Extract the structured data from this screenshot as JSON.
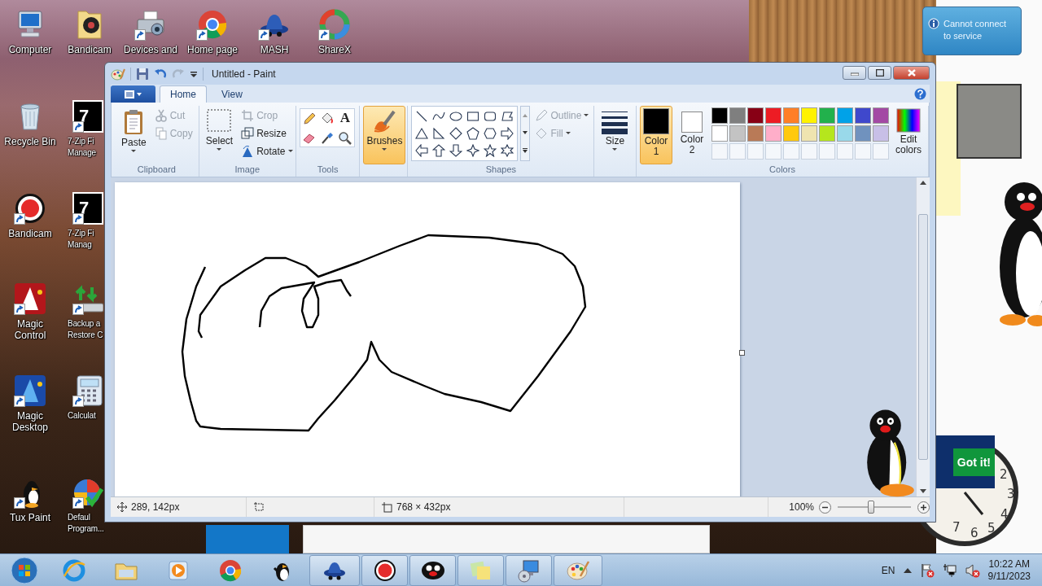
{
  "desktop_icons": [
    {
      "label": "Computer",
      "shortcut": false
    },
    {
      "label": "Bandicam",
      "shortcut": false
    },
    {
      "label": "Devices and",
      "shortcut": true
    },
    {
      "label": "Home page",
      "shortcut": true
    },
    {
      "label": "MASH",
      "shortcut": true
    },
    {
      "label": "ShareX",
      "shortcut": true
    },
    {
      "label": "Recycle Bin",
      "shortcut": false
    },
    {
      "label": "7-Zip Fi\nManage",
      "shortcut": true,
      "icon_text": "7"
    },
    {
      "label": "Bandicam",
      "shortcut": true
    },
    {
      "label": "7-Zip Fi\nManag",
      "shortcut": true,
      "icon_text": "7"
    },
    {
      "label": "Magic\nControl",
      "shortcut": true
    },
    {
      "label": "Backup a\nRestore C",
      "shortcut": true
    },
    {
      "label": "Magic\nDesktop",
      "shortcut": true
    },
    {
      "label": "Calculat",
      "shortcut": true
    },
    {
      "label": "Tux Paint",
      "shortcut": true
    },
    {
      "label": "Defaul\nProgram...",
      "shortcut": true
    }
  ],
  "balloon": {
    "message": "Cannot connect\nto service"
  },
  "promo": {
    "button": "Got it!"
  },
  "clock": {
    "numerals": [
      "2",
      "3",
      "4",
      "5",
      "6",
      "7"
    ]
  },
  "paint": {
    "title": "Untitled - Paint",
    "tabs": [
      {
        "label": "Home",
        "selected": true
      },
      {
        "label": "View",
        "selected": false
      }
    ],
    "clipboard": {
      "group": "Clipboard",
      "paste": "Paste",
      "cut": {
        "label": "Cut",
        "disabled": true
      },
      "copy": {
        "label": "Copy",
        "disabled": true
      }
    },
    "image": {
      "group": "Image",
      "select": "Select",
      "crop": {
        "label": "Crop",
        "disabled": true
      },
      "resize": {
        "label": "Resize",
        "disabled": false
      },
      "rotate": {
        "label": "Rotate",
        "disabled": false
      }
    },
    "tools": {
      "group": "Tools",
      "text_glyph": "A"
    },
    "brushes": {
      "label": "Brushes",
      "selected": true
    },
    "shapes": {
      "group": "Shapes",
      "outline": {
        "label": "Outline",
        "disabled": true
      },
      "fill": {
        "label": "Fill",
        "disabled": true
      }
    },
    "size": {
      "label": "Size"
    },
    "colors": {
      "group": "Colors",
      "color1": {
        "label": "Color 1",
        "color": "#000000",
        "selected": true
      },
      "color2": {
        "label": "Color 2",
        "color": "#ffffff",
        "selected": false
      },
      "palette": [
        {
          "kind": "color",
          "color": "#000000"
        },
        {
          "kind": "color",
          "color": "#7f7f7f"
        },
        {
          "kind": "color",
          "color": "#880015"
        },
        {
          "kind": "color",
          "color": "#ed1c24"
        },
        {
          "kind": "color",
          "color": "#ff7f27"
        },
        {
          "kind": "color",
          "color": "#fff200"
        },
        {
          "kind": "color",
          "color": "#22b14c"
        },
        {
          "kind": "color",
          "color": "#00a2e8"
        },
        {
          "kind": "color",
          "color": "#3f48cc"
        },
        {
          "kind": "color",
          "color": "#a349a4"
        },
        {
          "kind": "color",
          "color": "#ffffff"
        },
        {
          "kind": "color",
          "color": "#c3c3c3"
        },
        {
          "kind": "color",
          "color": "#b97a57"
        },
        {
          "kind": "color",
          "color": "#ffaec9"
        },
        {
          "kind": "color",
          "color": "#ffc90e"
        },
        {
          "kind": "color",
          "color": "#efe4b0"
        },
        {
          "kind": "color",
          "color": "#b5e61d"
        },
        {
          "kind": "color",
          "color": "#99d9ea"
        },
        {
          "kind": "color",
          "color": "#7092be"
        },
        {
          "kind": "color",
          "color": "#c8bfe7"
        },
        {
          "kind": "empty"
        },
        {
          "kind": "empty"
        },
        {
          "kind": "empty"
        },
        {
          "kind": "empty"
        },
        {
          "kind": "empty"
        },
        {
          "kind": "empty"
        },
        {
          "kind": "empty"
        },
        {
          "kind": "empty"
        },
        {
          "kind": "empty"
        },
        {
          "kind": "empty"
        }
      ],
      "edit": "Edit colors"
    },
    "status": {
      "cursor": "289, 142px",
      "dimensions": "768 × 432px",
      "zoom": "100%",
      "zoom_slider": {
        "level": 0.45
      }
    }
  },
  "taskbar": {
    "language": "EN",
    "time": "10:22 AM",
    "date": "9/11/2023",
    "items": [
      {
        "active": false
      },
      {
        "active": false
      },
      {
        "active": false
      },
      {
        "active": false
      },
      {
        "active": false
      },
      {
        "active": true
      },
      {
        "active": true
      },
      {
        "active": true
      },
      {
        "active": true
      },
      {
        "active": true
      },
      {
        "active": true
      }
    ]
  }
}
